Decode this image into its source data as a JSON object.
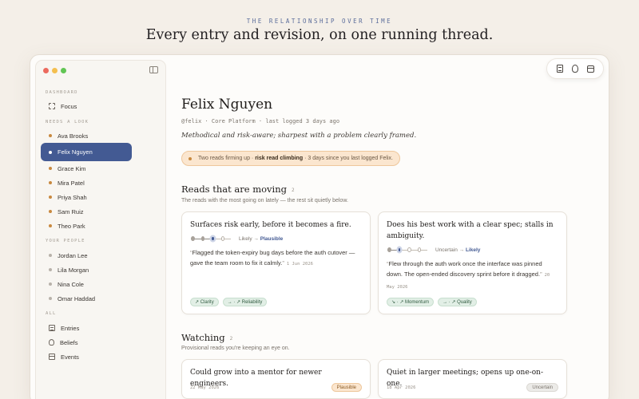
{
  "hero": {
    "eyebrow": "THE RELATIONSHIP OVER TIME",
    "title": "Every entry and revision, on one running thread."
  },
  "sidebar": {
    "sections": {
      "dashboard": "DASHBOARD",
      "needs_look": "NEEDS A LOOK",
      "your_people": "YOUR PEOPLE",
      "all": "ALL"
    },
    "focus_label": "Focus",
    "needs_look_items": [
      {
        "label": "Ava Brooks",
        "status": "amber"
      },
      {
        "label": "Felix Nguyen",
        "status": "active"
      },
      {
        "label": "Grace Kim",
        "status": "amber"
      },
      {
        "label": "Mira Patel",
        "status": "amber"
      },
      {
        "label": "Priya Shah",
        "status": "amber"
      },
      {
        "label": "Sam Ruiz",
        "status": "amber"
      },
      {
        "label": "Theo Park",
        "status": "amber"
      }
    ],
    "people_items": [
      {
        "label": "Jordan Lee"
      },
      {
        "label": "Lila Morgan"
      },
      {
        "label": "Nina Cole"
      },
      {
        "label": "Omar Haddad"
      }
    ],
    "all_items": {
      "entries": "Entries",
      "beliefs": "Beliefs",
      "events": "Events"
    }
  },
  "toolbar": {
    "icons": [
      "document-icon",
      "lightbulb-icon",
      "calendar-icon"
    ]
  },
  "person": {
    "name": "Felix Nguyen",
    "meta": "@felix · Core Platform · last logged 3 days ago",
    "summary": "Methodical and risk-aware; sharpest with a problem clearly framed.",
    "alert": {
      "prefix": "Two reads firming up ·",
      "highlight": "risk read climbing",
      "suffix": "· 3 days since you last logged Felix."
    }
  },
  "moving": {
    "title": "Reads that are moving",
    "count": "2",
    "subtitle": "The reads with the most going on lately — the rest sit quietly below.",
    "cards": [
      {
        "title": "Surfaces risk early, before it becomes a fire.",
        "from": "Likely",
        "to": "Plausible",
        "quote": "Flagged the token-expiry bug days before the auth cutover — gave the team room to fix it calmly.",
        "date": "1 Jun 2026",
        "tags": [
          "↗ Clarity",
          "→ · ↗ Reliability"
        ]
      },
      {
        "title": "Does his best work with a clear spec; stalls in ambiguity.",
        "from": "Uncertain",
        "to": "Likely",
        "quote": "Flew through the auth work once the interface was pinned down. The open-ended discovery sprint before it dragged.",
        "date": "20 May 2026",
        "tags": [
          "↘ · ↗ Momentum",
          "→ · ↗ Quality"
        ]
      }
    ]
  },
  "watching": {
    "title": "Watching",
    "count": "2",
    "subtitle": "Provisional reads you're keeping an eye on.",
    "cards": [
      {
        "title": "Could grow into a mentor for newer engineers.",
        "date": "22 May 2026",
        "badge": "Plausible"
      },
      {
        "title": "Quiet in larger meetings; opens up one-on-one.",
        "date": "18 Apr 2026",
        "badge": "Uncertain"
      }
    ]
  },
  "colors": {
    "accent": "#435a93",
    "amber": "#c8893f",
    "tag_green": "#e2efe6",
    "background": "#f4efe8"
  }
}
